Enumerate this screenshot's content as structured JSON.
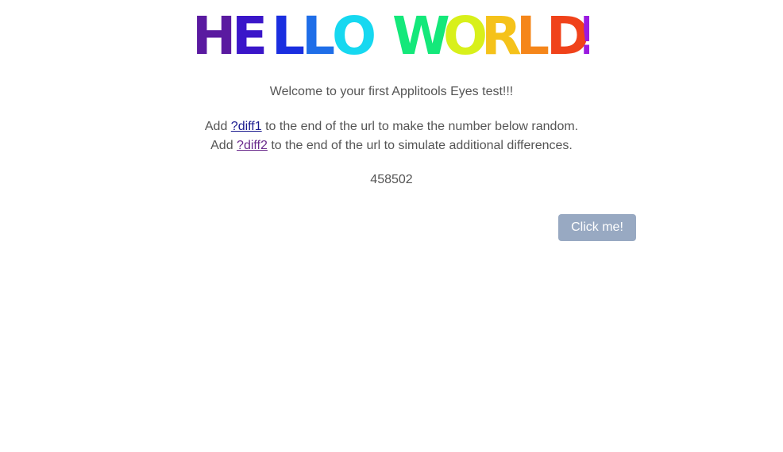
{
  "hero": {
    "text": "HELLO WORLD!",
    "letters": [
      {
        "char": "H",
        "color": "#5a1aa0"
      },
      {
        "char": "E",
        "color": "#3a16c9"
      },
      {
        "char": "L",
        "color": "#1a2ee0"
      },
      {
        "char": "L",
        "color": "#1f6ee8"
      },
      {
        "char": "O",
        "color": "#16d8f0"
      },
      {
        "char": "W",
        "color": "#14e87a"
      },
      {
        "char": "O",
        "color": "#d8f01a"
      },
      {
        "char": "R",
        "color": "#f5c21a"
      },
      {
        "char": "L",
        "color": "#f5861a"
      },
      {
        "char": "D",
        "color": "#f0421a"
      },
      {
        "char": "!",
        "color": "#9a1ae0"
      }
    ]
  },
  "welcome": "Welcome to your first Applitools Eyes test!!!",
  "diff1": {
    "prefix": "Add ",
    "link": "?diff1",
    "suffix": " to the end of the url to make the number below random."
  },
  "diff2": {
    "prefix": "Add ",
    "link": "?diff2",
    "suffix": " to the end of the url to simulate additional differences."
  },
  "number": "458502",
  "button": {
    "label": "Click me!",
    "color": "#98a9c2"
  }
}
